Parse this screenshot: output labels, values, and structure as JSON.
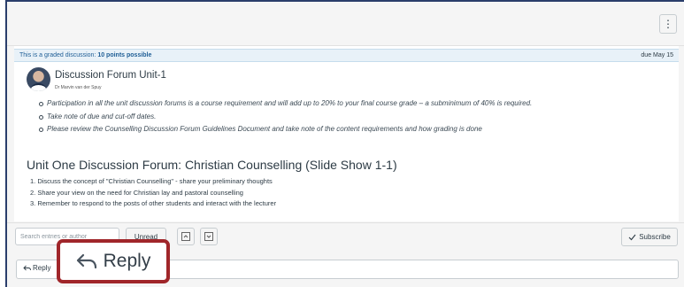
{
  "top_bar": {
    "menu_icon": "kebab-menu-icon",
    "menu_glyph": "⋮"
  },
  "graded_banner": {
    "prefix": "This is a graded discussion: ",
    "points": "10 points possible",
    "due": "due May 15"
  },
  "post": {
    "title": "Discussion Forum Unit-1",
    "author": "Dr Marvin van der Spuy",
    "bullets": [
      "Participation in all the unit discussion forums is a course requirement and will add up to 20% to your final course grade – a subminimum of 40% is required.",
      "Take note of due and cut-off dates.",
      "Please review the Counselling Discussion Forum Guidelines Document and take note of the content requirements and how grading is done"
    ],
    "heading": "Unit One Discussion Forum: Christian Counselling (Slide Show 1-1)",
    "numbered": [
      "1. Discuss the concept of \"Christian Counselling\" - share your preliminary thoughts",
      "2. Share your view on the need for Christian lay and pastoral counselling",
      "3. Remember to respond to the posts of other students and interact with the lecturer"
    ]
  },
  "toolbar": {
    "search_placeholder": "Search entries or author",
    "unread_label": "Unread",
    "collapse_icon": "collapse-threads-icon",
    "expand_icon": "expand-threads-icon",
    "subscribe_label": "Subscribe",
    "subscribe_icon": "checkmark-icon"
  },
  "reply": {
    "label": "Reply",
    "icon": "reply-arrow-icon"
  },
  "callout": {
    "label": "Reply",
    "border_color": "#a0262a"
  },
  "colors": {
    "frame_border": "#2a3e6b",
    "banner_text": "#1f5e96",
    "banner_bg": "#e8f1f8"
  }
}
